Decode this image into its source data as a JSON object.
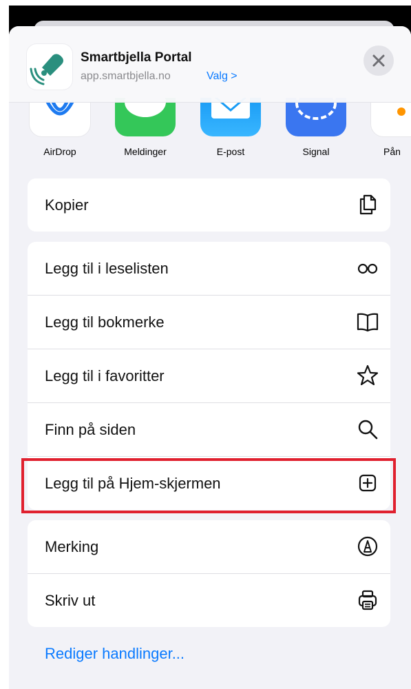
{
  "share_header": {
    "title": "Smartbjella Portal",
    "url": "app.smartbjella.no",
    "options_label": "Valg >",
    "site_icon": "smartbjella-bell-logo",
    "close_icon": "close-icon"
  },
  "apps": [
    {
      "label": "AirDrop",
      "icon": "airdrop-icon",
      "color": "#e9f3ff"
    },
    {
      "label": "Meldinger",
      "icon": "messages-icon",
      "color": "#34c759"
    },
    {
      "label": "E-post",
      "icon": "mail-icon",
      "color": "#2aa6f5"
    },
    {
      "label": "Signal",
      "icon": "signal-icon",
      "color": "#3a76f0"
    },
    {
      "label": "Pån",
      "icon": "photos-icon",
      "color": "#ffffff"
    }
  ],
  "action_groups": [
    [
      {
        "label": "Kopier",
        "icon": "copy-icon"
      }
    ],
    [
      {
        "label": "Legg til i leselisten",
        "icon": "glasses-icon"
      },
      {
        "label": "Legg til bokmerke",
        "icon": "book-icon"
      },
      {
        "label": "Legg til i favoritter",
        "icon": "star-icon"
      },
      {
        "label": "Finn på siden",
        "icon": "search-icon"
      },
      {
        "label": "Legg til på Hjem-skjermen",
        "icon": "plus-square-icon",
        "highlighted": true
      }
    ],
    [
      {
        "label": "Merking",
        "icon": "markup-icon"
      },
      {
        "label": "Skriv ut",
        "icon": "printer-icon"
      }
    ]
  ],
  "edit_actions_label": "Rediger handlinger...",
  "colors": {
    "accent": "#0a7aff",
    "highlight": "#e0202e",
    "sheet_bg": "#f2f2f7"
  }
}
